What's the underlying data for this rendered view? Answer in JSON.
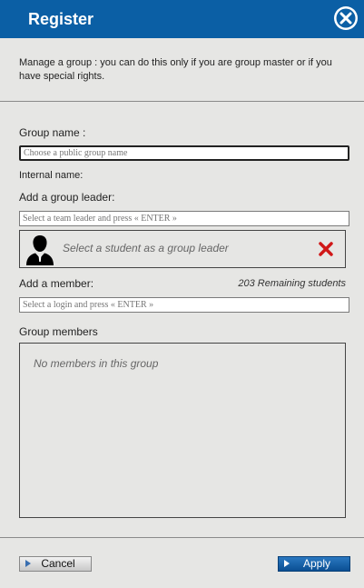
{
  "window": {
    "title": "Register"
  },
  "intro": "Manage a group : you can do this only if you are group master or if you have special rights.",
  "group_name": {
    "label": "Group name :",
    "placeholder": "Choose a public group name"
  },
  "internal_name": {
    "label": "Internal name:"
  },
  "group_leader": {
    "label": "Add a group leader:",
    "placeholder": "Select a team leader and press « ENTER »",
    "slot_text": "Select a student as a group leader"
  },
  "member": {
    "label": "Add a member:",
    "remaining": "203 Remaining students",
    "placeholder": "Select a login and press « ENTER »"
  },
  "members": {
    "label": "Group members",
    "empty_text": "No members in this group"
  },
  "buttons": {
    "cancel": "Cancel",
    "apply": "Apply"
  },
  "colors": {
    "titlebar": "#0b5fa5",
    "apply": "#0b5fa5",
    "remove": "#d01818"
  },
  "icons": {
    "close": "close-icon",
    "avatar": "user-silhouette-icon",
    "remove": "red-x-icon",
    "arrow": "play-arrow-icon"
  }
}
